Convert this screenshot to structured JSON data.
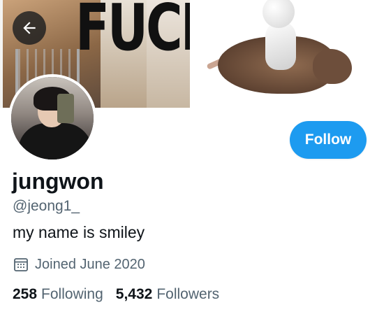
{
  "banner": {
    "word": "FUCK"
  },
  "header": {
    "back_icon": "arrow-left-icon"
  },
  "profile": {
    "follow_label": "Follow",
    "display_name": "jungwon",
    "handle": "@jeong1_",
    "bio": "my name is smiley",
    "joined": {
      "icon": "calendar-icon",
      "text": "Joined June 2020"
    },
    "stats": {
      "following_count": "258",
      "following_label": "Following",
      "followers_count": "5,432",
      "followers_label": "Followers"
    }
  },
  "colors": {
    "accent": "#1d9bf0",
    "text_primary": "#0f1419",
    "text_secondary": "#536471"
  }
}
